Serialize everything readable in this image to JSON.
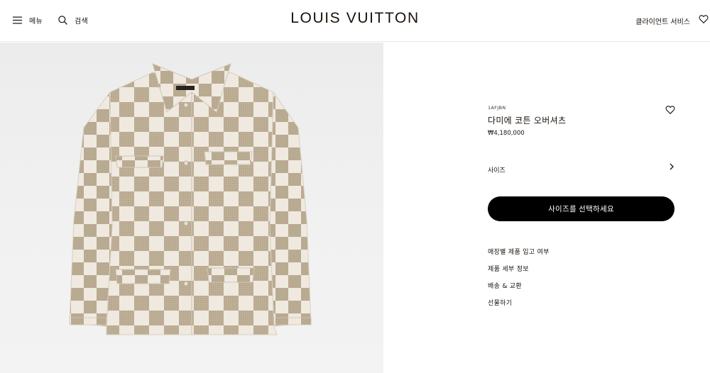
{
  "header": {
    "menu_label": "메뉴",
    "search_label": "검색",
    "logo": "LOUIS VUITTON",
    "client_service_label": "클라이언트 서비스"
  },
  "product": {
    "sku": "1AFJBN",
    "name": "다미에 코튼 오버셔츠",
    "price": "₩4,180,000",
    "size_label": "사이즈",
    "select_size_button": "사이즈를 선택하세요",
    "links": [
      "매장별 제품 입고 여부",
      "제품 세부 정보",
      "배송 & 교환",
      "선물하기"
    ]
  },
  "image": {
    "description_icon": "damier-overshirt-image",
    "primary_color": "#efe9df",
    "check_color": "#b8a88f"
  }
}
